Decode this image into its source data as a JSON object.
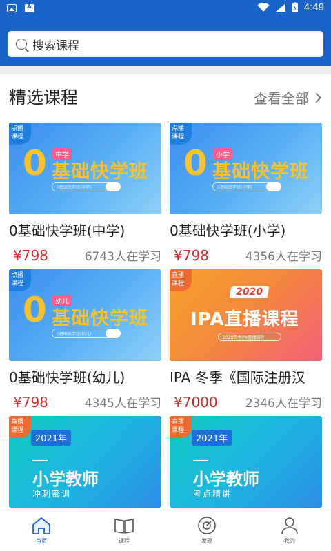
{
  "status_bar": {
    "time": "4:49"
  },
  "search": {
    "placeholder": "搜索课程"
  },
  "section": {
    "title": "精选课程",
    "view_all": "查看全部"
  },
  "courses": [
    {
      "tag": [
        "点播",
        "课程"
      ],
      "name": "0基础快学班(中学)",
      "price": "¥798",
      "learners": "6743人在学习",
      "banner": {
        "zero": "0",
        "title": "基础快学班",
        "level": "中学",
        "search_text": "0基础快学班(中学)"
      }
    },
    {
      "tag": [
        "点播",
        "课程"
      ],
      "name": "0基础快学班(小学)",
      "price": "¥798",
      "learners": "4356人在学习",
      "banner": {
        "zero": "0",
        "title": "基础快学班",
        "level": "小学",
        "search_text": "0基础快学班(小学)"
      }
    },
    {
      "tag": [
        "点播",
        "课程"
      ],
      "name": "0基础快学班(幼儿)",
      "price": "¥798",
      "learners": "4345人在学习",
      "banner": {
        "zero": "0",
        "title": "基础快学班",
        "level": "幼儿",
        "search_text": "0基础快学班(幼儿)"
      }
    },
    {
      "tag": [
        "直播",
        "课程"
      ],
      "name": "IPA 冬季《国际注册汉",
      "price": "¥7000",
      "learners": "2346人在学习",
      "banner": {
        "year": "2020",
        "title": "IPA直播课程",
        "bar_text": "2020冬季IPA直播课程"
      }
    },
    {
      "tag": [
        "直播",
        "课程"
      ],
      "banner": {
        "year": "2021年",
        "title": "小学教师",
        "subtitle": "冲刺密训"
      }
    },
    {
      "tag": [
        "直播",
        "课程"
      ],
      "banner": {
        "year": "2021年",
        "title": "小学教师",
        "subtitle": "考点精讲"
      }
    }
  ],
  "bottom_nav": [
    {
      "label": "首页",
      "icon": "home-icon",
      "active": true
    },
    {
      "label": "课程",
      "icon": "book-icon",
      "active": false
    },
    {
      "label": "发现",
      "icon": "discover-icon",
      "active": false
    },
    {
      "label": "我的",
      "icon": "user-icon",
      "active": false
    }
  ],
  "colors": {
    "primary": "#1a63c9",
    "price": "#e02424"
  }
}
